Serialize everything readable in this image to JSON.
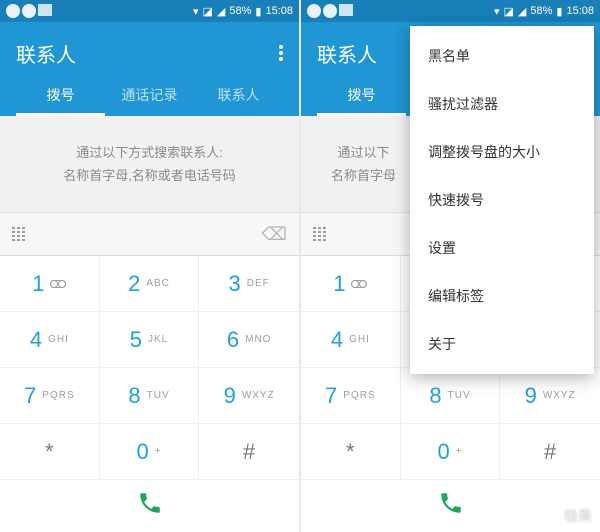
{
  "status": {
    "battery_pct": "58%",
    "time": "15:08"
  },
  "header": {
    "title": "联系人"
  },
  "tabs": [
    {
      "label": "拨号"
    },
    {
      "label": "通话记录"
    },
    {
      "label": "联系人"
    }
  ],
  "hint": {
    "line1": "通过以下方式搜索联系人:",
    "line2": "名称首字母,名称或者电话号码"
  },
  "hint_right": {
    "line1": "通过以下",
    "line2": "名称首字母"
  },
  "dialpad": [
    {
      "num": "1",
      "lbl": ""
    },
    {
      "num": "2",
      "lbl": "ABC"
    },
    {
      "num": "3",
      "lbl": "DEF"
    },
    {
      "num": "4",
      "lbl": "GHI"
    },
    {
      "num": "5",
      "lbl": "JKL"
    },
    {
      "num": "6",
      "lbl": "MNO"
    },
    {
      "num": "7",
      "lbl": "PQRS"
    },
    {
      "num": "8",
      "lbl": "TUV"
    },
    {
      "num": "9",
      "lbl": "WXYZ"
    },
    {
      "num": "*",
      "lbl": ""
    },
    {
      "num": "0",
      "lbl": "+"
    },
    {
      "num": "#",
      "lbl": ""
    }
  ],
  "menu": [
    "黑名单",
    "骚扰过滤器",
    "调整拨号盘的大小",
    "快速拨号",
    "设置",
    "编辑标签",
    "关于"
  ],
  "watermark": "极果"
}
